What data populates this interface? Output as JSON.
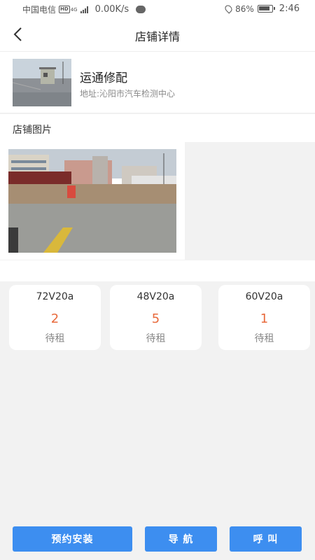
{
  "status_bar": {
    "carrier": "中国电信",
    "network_badge": "HD",
    "network_type": "4G",
    "speed": "0.00K/s",
    "battery": "86%",
    "time": "2:46",
    "icons": [
      "signal-icon",
      "chat-icon",
      "location-icon",
      "battery-icon"
    ]
  },
  "header": {
    "title": "店铺详情",
    "back_icon": "back-arrow-icon"
  },
  "shop": {
    "name": "运通修配",
    "address": "地址:沁阳市汽车检测中心"
  },
  "photos": {
    "label": "店铺图片"
  },
  "batteries": [
    {
      "model": "72V20a",
      "count": "2",
      "status": "待租"
    },
    {
      "model": "48V20a",
      "count": "5",
      "status": "待租"
    },
    {
      "model": "60V20a",
      "count": "1",
      "status": "待租"
    }
  ],
  "actions": {
    "install": "预约安装",
    "navigate": "导 航",
    "call": "呼 叫"
  },
  "colors": {
    "accent": "#3d8ef0",
    "count": "#e86a3c",
    "background": "#f2f2f2"
  }
}
